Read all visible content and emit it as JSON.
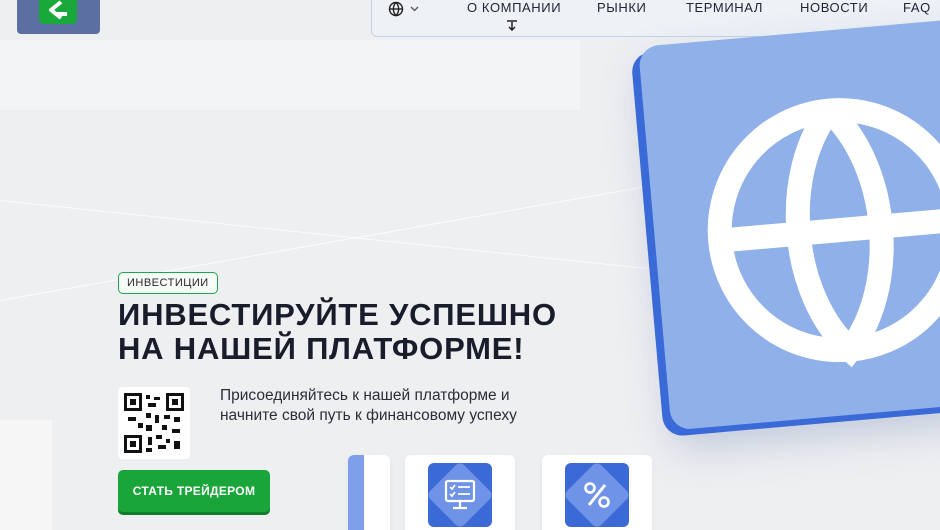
{
  "header": {
    "logo_icon": "brand-logo-icon",
    "lang_icon": "globe-icon",
    "nav": [
      "О КОМПАНИИ",
      "РЫНКИ",
      "ТЕРМИНАЛ",
      "НОВОСТИ",
      "FAQ"
    ]
  },
  "hero": {
    "badge": "ИНВЕСТИЦИИ",
    "headline_line1": "ИНВЕСТИРУЙТЕ УСПЕШНО",
    "headline_line2": "НА НАШЕЙ ПЛАТФОРМЕ!",
    "subtext_line1": "Присоединяйтесь к нашей платформе и",
    "subtext_line2": "начните свой путь к финансовому успеху",
    "cta_label": "СТАТЬ ТРЕЙДЕРОМ",
    "qr_icon": "qr-code-icon",
    "illustration_icon": "globe-icon"
  },
  "features": {
    "icons": [
      "monitor-checklist-icon",
      "percent-icon"
    ]
  },
  "colors": {
    "brand_green": "#19a53a",
    "accent_blue": "#3b69d6",
    "card_blue": "#8fb0e8"
  }
}
